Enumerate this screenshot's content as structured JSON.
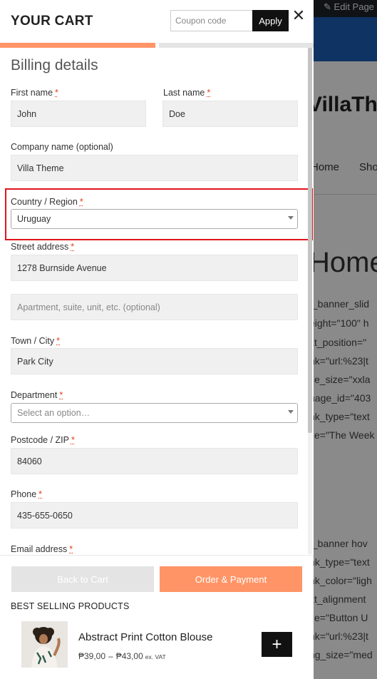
{
  "background_page": {
    "edit_page": "Edit Page",
    "site_title": "VillaThe",
    "nav": [
      "Home",
      "Sho"
    ],
    "page_title": "Home",
    "code_lines": [
      "t_banner_slid",
      "eight=\"100\" h",
      "xt_position=\"",
      "nk=\"url:%23|t",
      "tle_size=\"xxla",
      "nage_id=\"403",
      "nk_type=\"text",
      "tle=\"The Week",
      "",
      "",
      "t_banner hov",
      "nk_type=\"text",
      "nk_color=\"ligh",
      "xt_alignment",
      "tle=\"Button U",
      "nk=\"url:%23|t",
      "ng_size=\"med"
    ]
  },
  "cart": {
    "title": "YOUR CART",
    "coupon_placeholder": "Coupon code",
    "apply_label": "Apply",
    "close_symbol": "✕",
    "progress": 0.5,
    "billing": {
      "title": "Billing details",
      "first_name": {
        "label": "First name",
        "value": "John"
      },
      "last_name": {
        "label": "Last name",
        "value": "Doe"
      },
      "company": {
        "label": "Company name (optional)",
        "value": "Villa Theme"
      },
      "country": {
        "label": "Country / Region",
        "value": "Uruguay"
      },
      "street": {
        "label": "Street address",
        "value": "1278 Burnside Avenue",
        "apt_placeholder": "Apartment, suite, unit, etc. (optional)"
      },
      "city": {
        "label": "Town / City",
        "value": "Park City"
      },
      "department": {
        "label": "Department",
        "placeholder": "Select an option…"
      },
      "postcode": {
        "label": "Postcode / ZIP",
        "value": "84060"
      },
      "phone": {
        "label": "Phone",
        "value": "435-655-0650"
      },
      "email": {
        "label": "Email address"
      },
      "required_mark": "*"
    },
    "buttons": {
      "back": "Back to Cart",
      "order": "Order & Payment"
    },
    "best_selling": {
      "title": "BEST SELLING PRODUCTS",
      "product": {
        "name": "Abstract Print Cotton Blouse",
        "price_min": "₱39,00",
        "price_sep": "–",
        "price_max": "₱43,00",
        "vat": "ex. VAT",
        "add": "+"
      }
    }
  },
  "colors": {
    "accent": "#ff9567",
    "highlight": "#e0141e",
    "admin_bar": "#1d2327",
    "header_blue": "#1c5fb8"
  }
}
